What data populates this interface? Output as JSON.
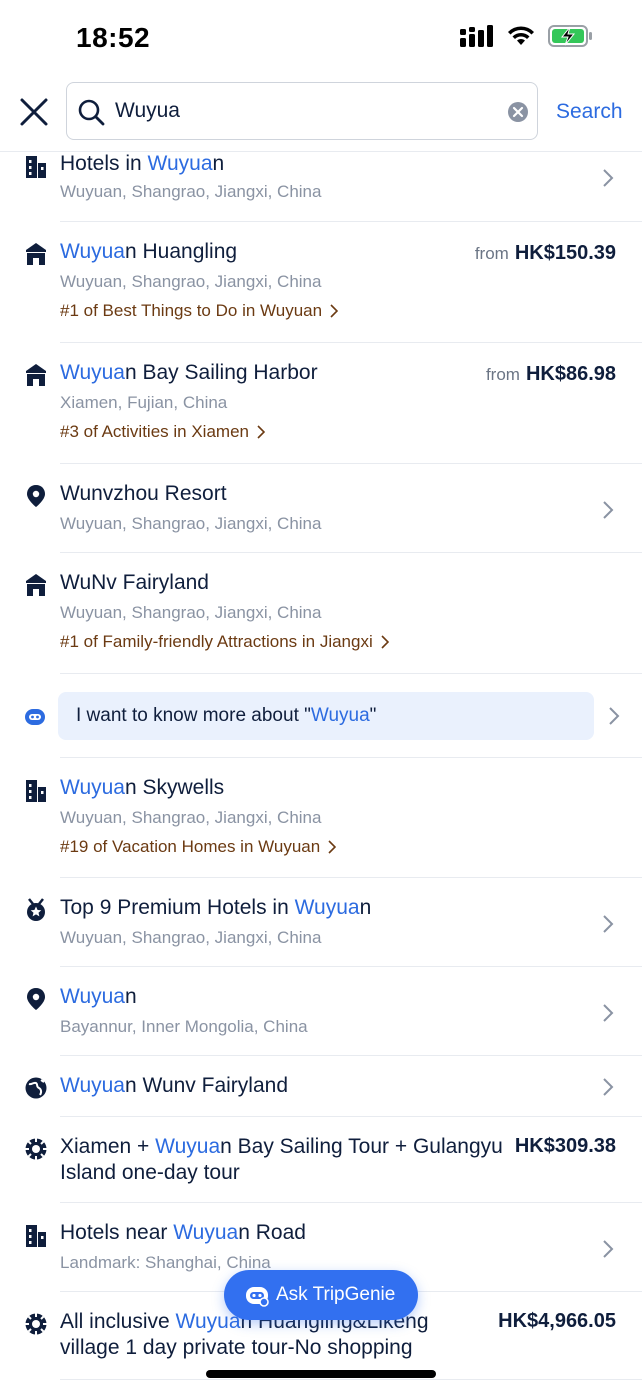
{
  "status": {
    "time": "18:52"
  },
  "search": {
    "query": "Wuyua",
    "action_label": "Search"
  },
  "results": [
    {
      "icon": "building-icon",
      "title_hl": "Wuyua",
      "title_pre": "Hotels in ",
      "title_post": "n",
      "sub": "Wuyuan, Shangrao, Jiangxi, China"
    },
    {
      "icon": "attraction-icon",
      "title_pre": "",
      "title_hl": "Wuyua",
      "title_post": "n Huangling",
      "sub": "Wuyuan, Shangrao, Jiangxi, China",
      "rank": "#1 of Best Things to Do in Wuyuan",
      "from": "from",
      "price": "HK$150.39"
    },
    {
      "icon": "attraction-icon",
      "title_pre": "",
      "title_hl": "Wuyua",
      "title_post": "n Bay Sailing Harbor",
      "sub": "Xiamen, Fujian, China",
      "rank": "#3 of Activities in Xiamen",
      "from": "from",
      "price": "HK$86.98"
    },
    {
      "icon": "location-pin-icon",
      "title_pre": "Wunvzhou Resort",
      "title_hl": "",
      "title_post": "",
      "sub": "Wuyuan, Shangrao, Jiangxi, China"
    },
    {
      "icon": "attraction-icon",
      "title_pre": "WuNv Fairyland",
      "title_hl": "",
      "title_post": "",
      "sub": "Wuyuan, Shangrao, Jiangxi, China",
      "rank": "#1 of Family-friendly Attractions in Jiangxi"
    },
    {
      "icon": "building-icon",
      "title_pre": "",
      "title_hl": "Wuyua",
      "title_post": "n Skywells",
      "sub": "Wuyuan, Shangrao, Jiangxi, China",
      "rank": "#19 of Vacation Homes in Wuyuan"
    },
    {
      "icon": "award-icon",
      "title_pre": "Top 9 Premium Hotels in ",
      "title_hl": "Wuyua",
      "title_post": "n",
      "sub": "Wuyuan, Shangrao, Jiangxi, China"
    },
    {
      "icon": "location-pin-icon",
      "title_pre": "",
      "title_hl": "Wuyua",
      "title_post": "n",
      "sub": "Bayannur, Inner Mongolia, China"
    },
    {
      "icon": "globe-icon",
      "title_pre": "",
      "title_hl": "Wuyua",
      "title_post": "n Wunv Fairyland"
    },
    {
      "icon": "tour-icon",
      "title_pre": "Xiamen + ",
      "title_hl": "Wuyua",
      "title_post": "n Bay Sailing Tour + Gulangyu",
      "title_line2": "Island one-day tour",
      "price": "HK$309.38"
    },
    {
      "icon": "building-icon",
      "title_pre": "Hotels near ",
      "title_hl": "Wuyua",
      "title_post": "n Road",
      "sub": "Landmark: Shanghai, China"
    },
    {
      "icon": "tour-icon",
      "title_pre": "All inclusive ",
      "title_hl": "Wuyua",
      "title_post": "n Huangling&Likeng",
      "title_line2": "village 1 day private tour-No shopping",
      "price": "HK$4,966.05"
    }
  ],
  "ai_prompt": {
    "pre": "I want to know more about \"",
    "hl": "Wuyua",
    "post": "\""
  },
  "fab": {
    "label": "Ask TripGenie"
  },
  "colors": {
    "accent": "#2c6be0",
    "rank": "#6b3a12",
    "fab": "#3270f0"
  }
}
